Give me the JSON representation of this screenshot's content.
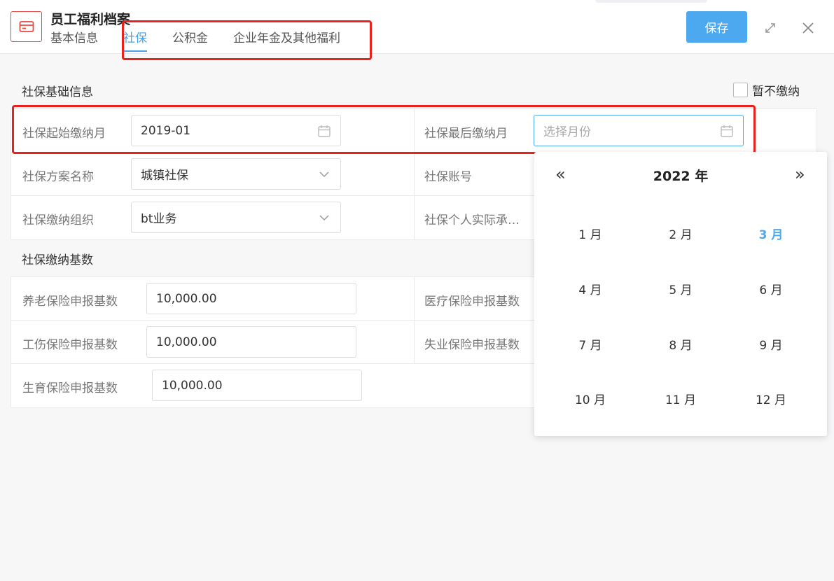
{
  "header": {
    "title": "员工福利档案",
    "save_label": "保存",
    "tabs": [
      {
        "label": "基本信息"
      },
      {
        "label": "社保"
      },
      {
        "label": "公积金"
      },
      {
        "label": "企业年金及其他福利"
      }
    ],
    "active_tab": "社保"
  },
  "basic_section": {
    "title": "社保基础信息",
    "opt_out_label": "暂不缴纳",
    "start_month_label": "社保起始缴纳月",
    "start_month_value": "2019-01",
    "end_month_label": "社保最后缴纳月",
    "end_month_placeholder": "选择月份",
    "plan_label": "社保方案名称",
    "plan_value": "城镇社保",
    "account_label": "社保账号",
    "org_label": "社保缴纳组织",
    "org_value": "bt业务",
    "personal_label": "社保个人实际承…"
  },
  "base_section": {
    "title": "社保缴纳基数",
    "pension_label": "养老保险申报基数",
    "pension_value": "10,000.00",
    "medical_label": "医疗保险申报基数",
    "injury_label": "工伤保险申报基数",
    "injury_value": "10,000.00",
    "unemployment_label": "失业保险申报基数",
    "maternity_label": "生育保险申报基数",
    "maternity_value": "10,000.00"
  },
  "calendar": {
    "prev_label": "«",
    "next_label": "»",
    "year_label": "2022 年",
    "months": [
      "1 月",
      "2 月",
      "3 月",
      "4 月",
      "5 月",
      "6 月",
      "7 月",
      "8 月",
      "9 月",
      "10 月",
      "11 月",
      "12 月"
    ],
    "current_month": "3 月"
  },
  "colors": {
    "accent": "#4da9ef",
    "highlight": "#e8231d"
  },
  "icons": [
    "card-icon",
    "calendar-icon",
    "chevron-down-icon",
    "expand-icon",
    "close-icon"
  ]
}
